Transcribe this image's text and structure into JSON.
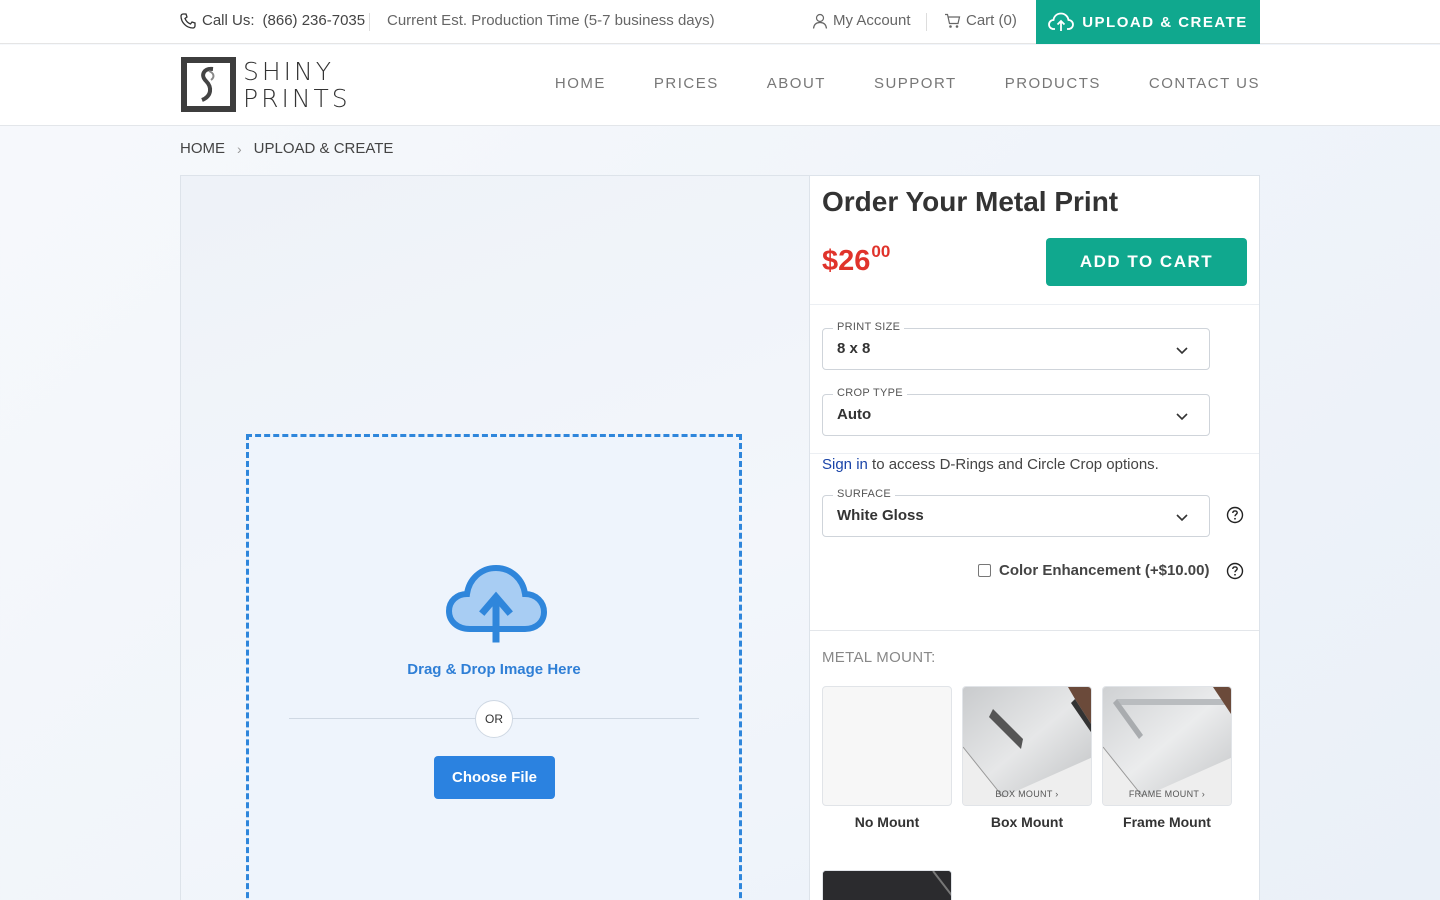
{
  "topbar": {
    "call_label": "Call Us:",
    "phone": "(866) 236-7035",
    "production_time": "Current Est. Production Time (5-7 business days)",
    "account": "My Account",
    "cart": "Cart (0)",
    "upload_create": "UPLOAD & CREATE"
  },
  "header": {
    "logo_line1": "SHINY",
    "logo_line2": "PRINTS",
    "nav": [
      "HOME",
      "PRICES",
      "ABOUT",
      "SUPPORT",
      "PRODUCTS",
      "CONTACT US"
    ]
  },
  "breadcrumb": {
    "home": "HOME",
    "current": "UPLOAD & CREATE"
  },
  "upload": {
    "drag_text": "Drag & Drop Image Here",
    "or": "OR",
    "choose_file": "Choose File"
  },
  "order": {
    "title": "Order Your Metal Print",
    "price_dollars": "$26",
    "price_cents": "00",
    "add_to_cart": "ADD TO CART",
    "print_size": {
      "label": "PRINT SIZE",
      "value": "8 x 8"
    },
    "crop_type": {
      "label": "CROP TYPE",
      "value": "Auto"
    },
    "signin_link": "Sign in",
    "signin_rest": " to access D-Rings and Circle Crop options.",
    "surface": {
      "label": "SURFACE",
      "value": "White Gloss"
    },
    "color_enhancement": "Color Enhancement (+$10.00)",
    "color_enhancement_checked": false,
    "mount_label": "METAL MOUNT:",
    "mounts": [
      {
        "name": "No Mount",
        "tag": ""
      },
      {
        "name": "Box Mount",
        "tag": "BOX MOUNT ›"
      },
      {
        "name": "Frame Mount",
        "tag": "FRAME MOUNT ›"
      }
    ]
  },
  "colors": {
    "accent_green": "#10a88e",
    "price_red": "#e0332b",
    "upload_blue": "#2f86db"
  }
}
